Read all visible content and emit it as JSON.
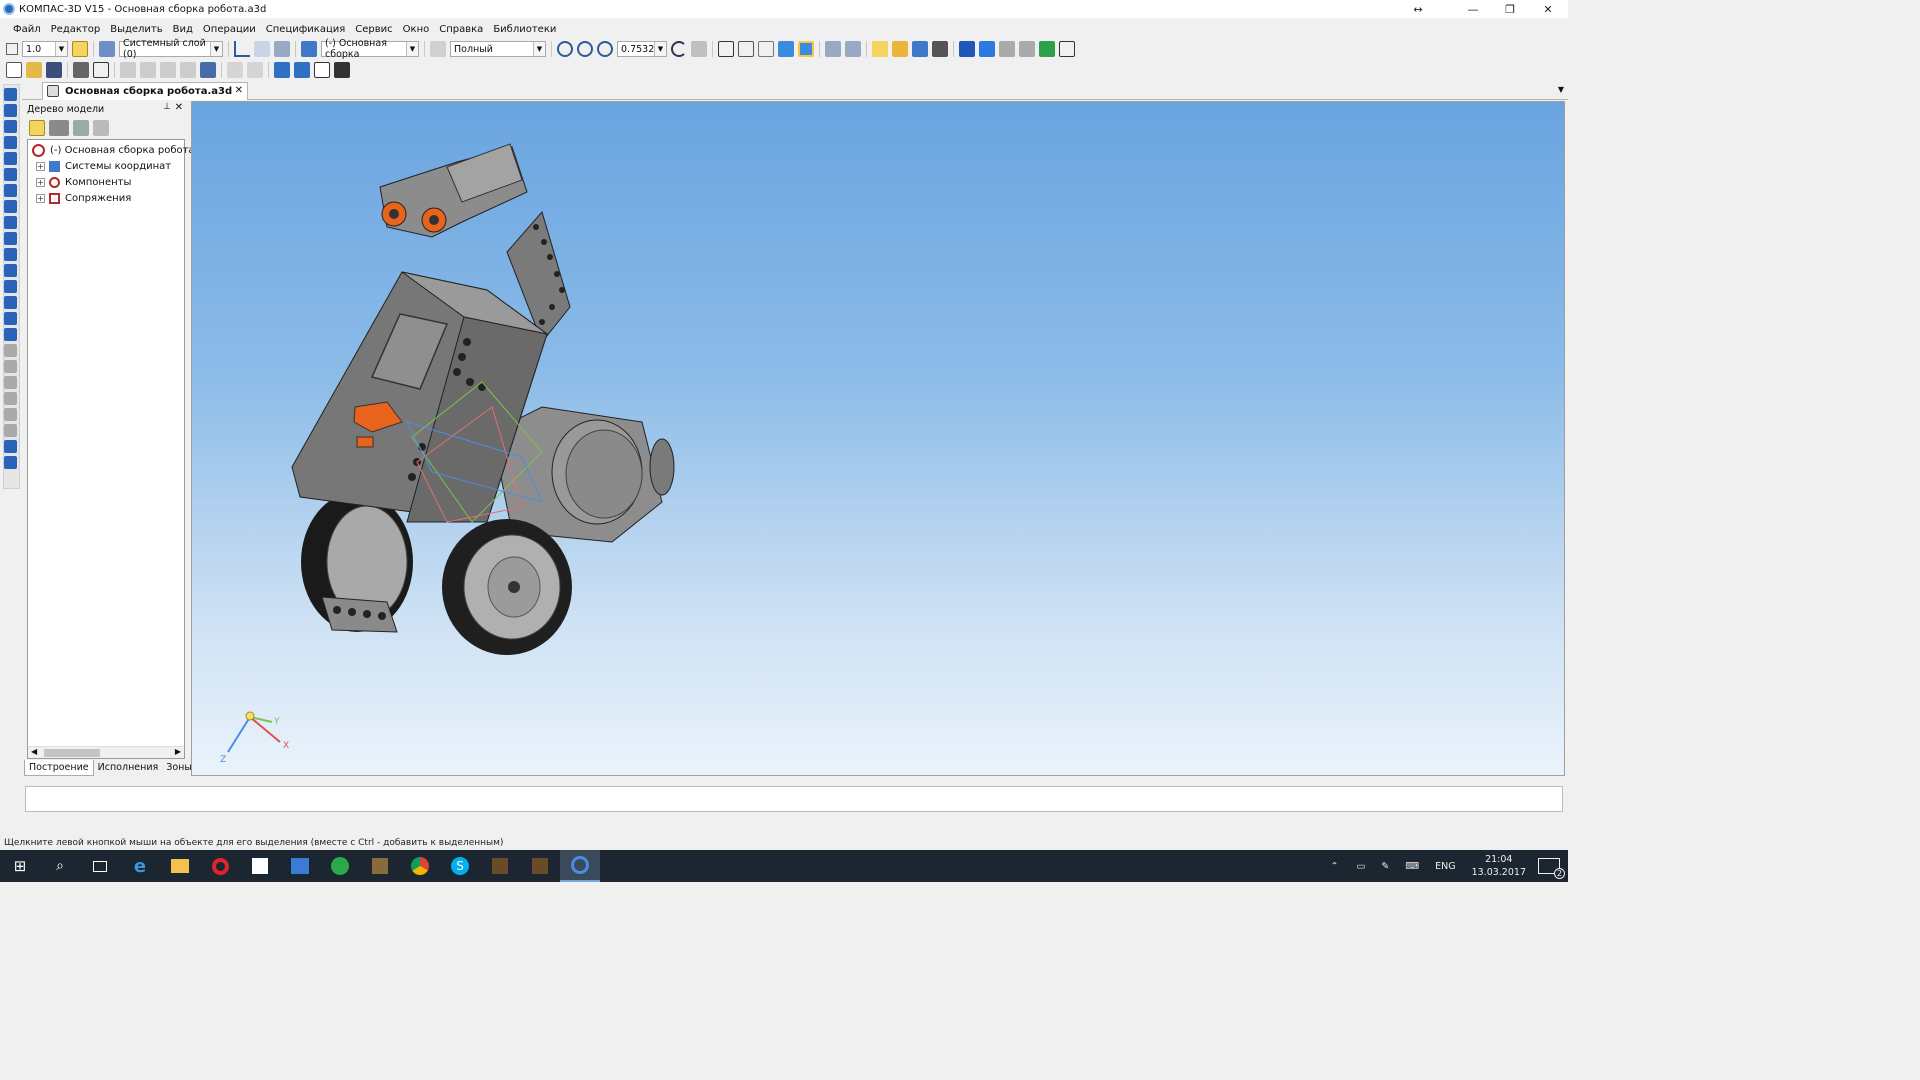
{
  "window": {
    "title": "КОМПАС-3D V15 - Основная сборка робота.a3d"
  },
  "menu": [
    "Файл",
    "Редактор",
    "Выделить",
    "Вид",
    "Операции",
    "Спецификация",
    "Сервис",
    "Окно",
    "Справка",
    "Библиотеки"
  ],
  "toolbar": {
    "step_value": "1.0",
    "layer_value": "Системный слой (0)",
    "assembly_value": "(-) Основная сборка",
    "display_mode_value": "Полный",
    "zoom_value": "0.7532"
  },
  "document_tab": {
    "label": "Основная сборка робота.a3d"
  },
  "model_tree": {
    "header": "Дерево модели",
    "root": "(-) Основная сборка робота (",
    "items": [
      "Системы координат",
      "Компоненты",
      "Сопряжения"
    ],
    "tabs": [
      "Построение",
      "Исполнения",
      "Зоны"
    ]
  },
  "axes": {
    "x": "X",
    "y": "Y",
    "z": "Z"
  },
  "status_text": "Щелкните левой кнопкой мыши на объекте для его выделения (вместе с Ctrl - добавить к выделенным)",
  "taskbar": {
    "language": "ENG",
    "time": "21:04",
    "date": "13.03.2017",
    "notifications": "2"
  },
  "colors": {
    "viewport_top": "#6aa4e0",
    "viewport_bottom": "#eaf3fb",
    "taskbar": "#1c2630",
    "part_gray": "#8a8a8a",
    "accent_orange": "#e8631c"
  }
}
